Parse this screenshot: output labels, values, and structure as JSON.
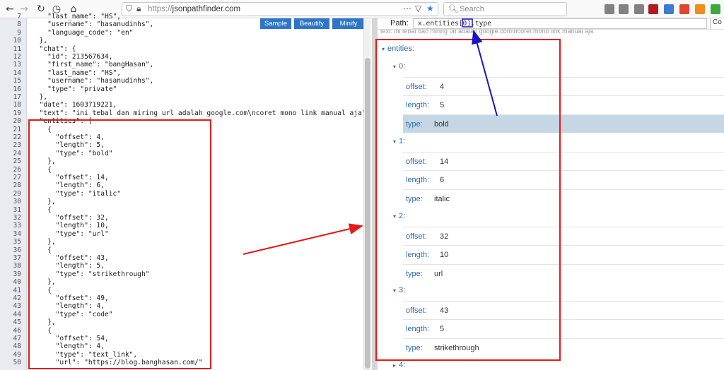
{
  "browser": {
    "url_prefix": "https://",
    "url_host": "jsonpathfinder.com",
    "search_placeholder": "Search",
    "ext_icons": [
      {
        "name": "library-icon",
        "color": "#5a5a5a"
      },
      {
        "name": "sidebar-icon",
        "color": "#5a5a5a"
      },
      {
        "name": "wrench-icon",
        "color": "#5a5a5a"
      },
      {
        "name": "ublock-icon",
        "color": "#b11c1c"
      },
      {
        "name": "mail-icon",
        "color": "#3d7bd1"
      },
      {
        "name": "addon-red-icon",
        "color": "#e0462d"
      },
      {
        "name": "addon-orange-icon",
        "color": "#f08c1a"
      },
      {
        "name": "addon-green-icon",
        "color": "#3caa3c"
      }
    ]
  },
  "editor": {
    "buttons": [
      "Sample",
      "Beautify",
      "Minify"
    ],
    "lines": [
      {
        "n": "7",
        "text": "    \"last_name\": \"HS\","
      },
      {
        "n": "8",
        "text": "    \"username\": \"hasanudinhs\","
      },
      {
        "n": "9",
        "text": "    \"language_code\": \"en\""
      },
      {
        "n": "10",
        "text": "  },"
      },
      {
        "n": "11",
        "text": "  \"chat\": {"
      },
      {
        "n": "12",
        "text": "    \"id\": 213567634,"
      },
      {
        "n": "13",
        "text": "    \"first_name\": \"bangHasan\","
      },
      {
        "n": "14",
        "text": "    \"last_name\": \"HS\","
      },
      {
        "n": "15",
        "text": "    \"username\": \"hasanudinhs\","
      },
      {
        "n": "16",
        "text": "    \"type\": \"private\""
      },
      {
        "n": "17",
        "text": "  },"
      },
      {
        "n": "18",
        "text": "  \"date\": 1603719221,"
      },
      {
        "n": "19",
        "text": "  \"text\": \"ini tebal dan miring url adalah google.com\\ncoret mono link manual aja\","
      },
      {
        "n": "20",
        "text": "  \"entities\": ["
      },
      {
        "n": "21",
        "text": "    {"
      },
      {
        "n": "22",
        "text": "      \"offset\": 4,"
      },
      {
        "n": "23",
        "text": "      \"length\": 5,"
      },
      {
        "n": "24",
        "text": "      \"type\": \"bold\""
      },
      {
        "n": "25",
        "text": "    },"
      },
      {
        "n": "26",
        "text": "    {"
      },
      {
        "n": "27",
        "text": "      \"offset\": 14,"
      },
      {
        "n": "28",
        "text": "      \"length\": 6,"
      },
      {
        "n": "29",
        "text": "      \"type\": \"italic\""
      },
      {
        "n": "30",
        "text": "    },"
      },
      {
        "n": "31",
        "text": "    {"
      },
      {
        "n": "32",
        "text": "      \"offset\": 32,"
      },
      {
        "n": "33",
        "text": "      \"length\": 10,"
      },
      {
        "n": "34",
        "text": "      \"type\": \"url\""
      },
      {
        "n": "35",
        "text": "    },"
      },
      {
        "n": "36",
        "text": "    {"
      },
      {
        "n": "37",
        "text": "      \"offset\": 43,"
      },
      {
        "n": "38",
        "text": "      \"length\": 5,"
      },
      {
        "n": "39",
        "text": "      \"type\": \"strikethrough\""
      },
      {
        "n": "40",
        "text": "    },"
      },
      {
        "n": "41",
        "text": "    {"
      },
      {
        "n": "42",
        "text": "      \"offset\": 49,"
      },
      {
        "n": "43",
        "text": "      \"length\": 4,"
      },
      {
        "n": "44",
        "text": "      \"type\": \"code\""
      },
      {
        "n": "45",
        "text": "    },"
      },
      {
        "n": "46",
        "text": "    {"
      },
      {
        "n": "47",
        "text": "      \"offset\": 54,"
      },
      {
        "n": "48",
        "text": "      \"length\": 4,"
      },
      {
        "n": "49",
        "text": "      \"type\": \"text_link\","
      },
      {
        "n": "50",
        "text": "      \"url\": \"https://blog.banghasan.com/\""
      }
    ]
  },
  "tree": {
    "path_label": "Path:",
    "path_value": "x.entities[0].type",
    "path_cut": "Co",
    "ghost_text": "text:     ini tebal dan miring url adalah google.com\\ncoret mono link manual aja",
    "root_label": "entities:",
    "items": [
      {
        "index": "0:",
        "rows": [
          {
            "key": "offset:",
            "value": "4"
          },
          {
            "key": "length:",
            "value": "5"
          },
          {
            "key": "type:",
            "value": "bold",
            "selected": true
          }
        ]
      },
      {
        "index": "1:",
        "rows": [
          {
            "key": "offset:",
            "value": "14"
          },
          {
            "key": "length:",
            "value": "6"
          },
          {
            "key": "type:",
            "value": "italic"
          }
        ]
      },
      {
        "index": "2:",
        "rows": [
          {
            "key": "offset:",
            "value": "32"
          },
          {
            "key": "length:",
            "value": "10"
          },
          {
            "key": "type:",
            "value": "url"
          }
        ]
      },
      {
        "index": "3:",
        "rows": [
          {
            "key": "offset:",
            "value": "43"
          },
          {
            "key": "length:",
            "value": "5"
          },
          {
            "key": "type:",
            "value": "strikethrough"
          }
        ]
      }
    ],
    "next_index": "4:"
  },
  "colors": {
    "annotation_red": "#e41b17",
    "annotation_blue": "#1515c8",
    "button_blue": "#2d76c7",
    "selection": "#c5d7e5"
  }
}
